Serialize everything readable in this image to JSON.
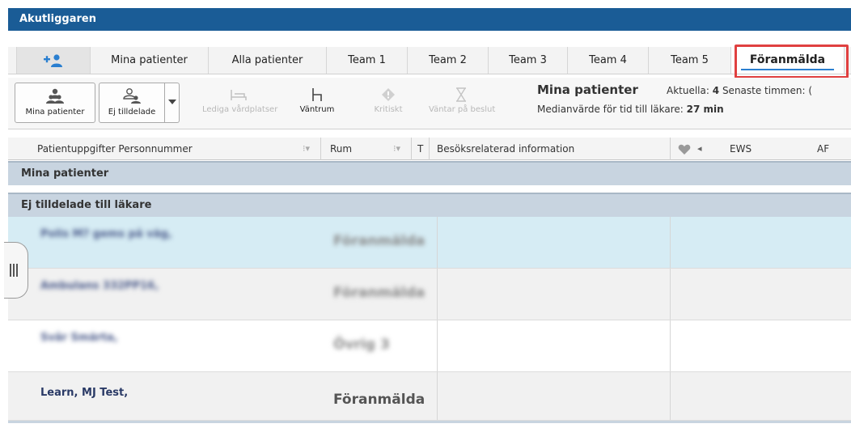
{
  "app": {
    "title": "Akutliggaren"
  },
  "tabs": [
    {
      "label": "",
      "icon": "add-user-icon"
    },
    {
      "label": "Mina patienter"
    },
    {
      "label": "Alla patienter"
    },
    {
      "label": "Team 1"
    },
    {
      "label": "Team 2"
    },
    {
      "label": "Team 3"
    },
    {
      "label": "Team 4"
    },
    {
      "label": "Team 5"
    },
    {
      "label": "Föranmälda",
      "active": true
    }
  ],
  "toolbar": {
    "my_patients": "Mina patienter",
    "unassigned": "Ej tilldelade",
    "free_beds": "Lediga vårdplatser",
    "waiting_room": "Väntrum",
    "critical": "Kritiskt",
    "awaiting_decision": "Väntar på beslut"
  },
  "info": {
    "title": "Mina patienter",
    "current_label": "Aktuella:",
    "current_value": "4",
    "last_hour_label": "Senaste timmen: (",
    "median_label": "Medianvärde för tid till läkare:",
    "median_value": "27 min"
  },
  "columns": {
    "patient": "Patientuppgifter Personnummer",
    "room": "Rum",
    "t": "T",
    "visit_info": "Besöksrelaterad information",
    "ews": "EWS",
    "af": "AF"
  },
  "groups": {
    "mine": "Mina patienter",
    "unassigned": "Ej tilldelade till läkare"
  },
  "rows": [
    {
      "name": "Polis M? gems på väg,",
      "room": "Föranmälda",
      "blurred": true,
      "selected": true
    },
    {
      "name": "Ambulans 332PP16,",
      "room": "Föranmälda",
      "blurred": true,
      "selected": false
    },
    {
      "name": "Svår Smärta,",
      "room": "Övrig 3",
      "blurred": true,
      "selected": false
    },
    {
      "name": "Learn, MJ Test,",
      "room": "Föranmälda",
      "blurred": false,
      "selected": false
    }
  ],
  "colors": {
    "titlebar": "#1a5c96",
    "tab_underline": "#2a7fd0",
    "highlight_box": "#e04040",
    "group_header": "#c8d4e0",
    "selected_row": "#d6ecf4"
  }
}
